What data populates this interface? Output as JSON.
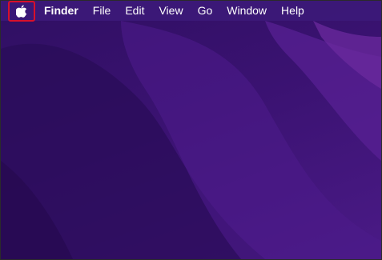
{
  "menubar": {
    "apple_icon": "apple-logo-icon",
    "app_name": "Finder",
    "items": [
      "File",
      "Edit",
      "View",
      "Go",
      "Window",
      "Help"
    ]
  },
  "colors": {
    "highlight_border": "#d8102a",
    "menubar_bg": "#3c1978",
    "wallpaper_dark": "#2f0f62",
    "wallpaper_light": "#6b2aa0"
  }
}
